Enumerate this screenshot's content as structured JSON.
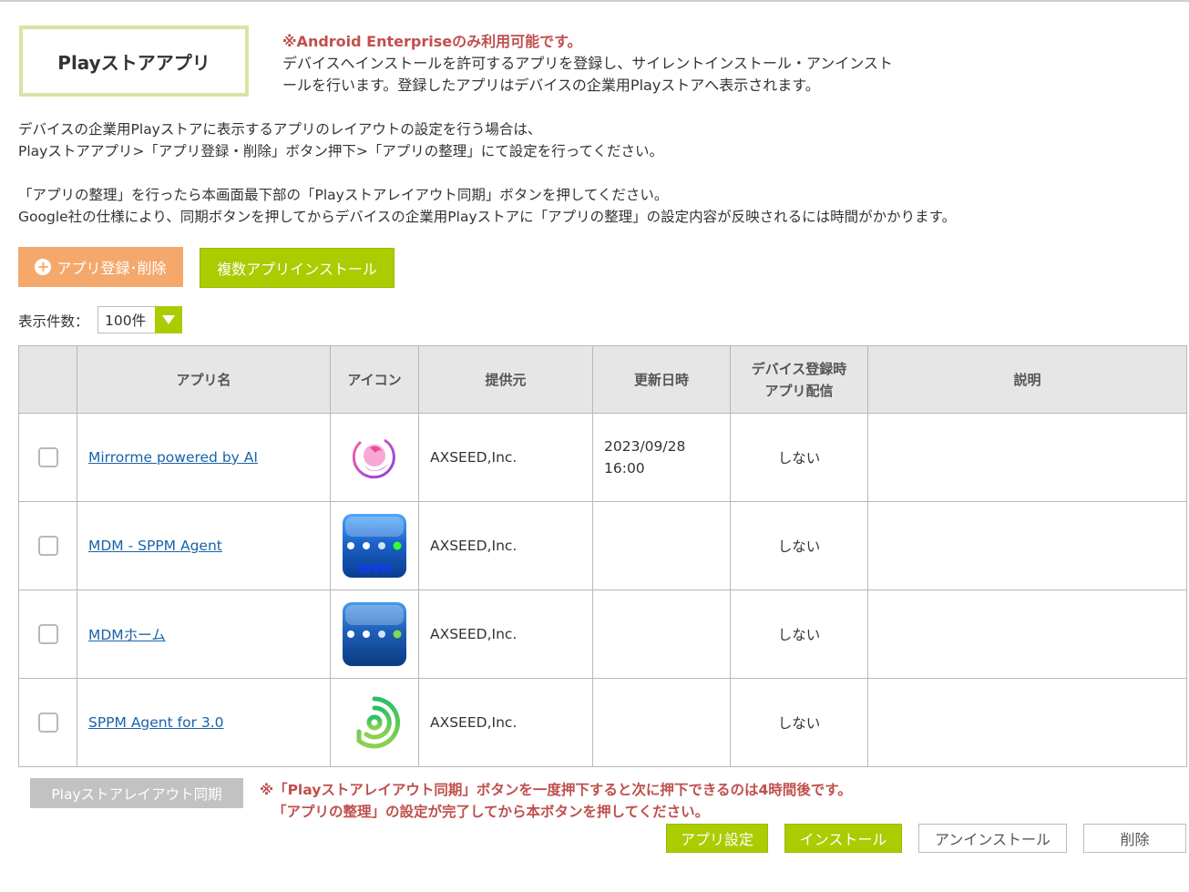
{
  "page": {
    "title": "Playストアアプリ",
    "notice": "※Android Enterpriseのみ利用可能です。",
    "description_line1": "デバイスへインストールを許可するアプリを登録し、サイレントインストール・アンインスト",
    "description_line2": "ールを行います。登録したアプリはデバイスの企業用Playストアへ表示されます。",
    "info_line1": "デバイスの企業用Playストアに表示するアプリのレイアウトの設定を行う場合は、",
    "info_line2": "Playストアアプリ>「アプリ登録・削除」ボタン押下>「アプリの整理」にて設定を行ってください。",
    "info_line3": "「アプリの整理」を行ったら本画面最下部の「Playストアレイアウト同期」ボタンを押してください。",
    "info_line4": "Google社の仕様により、同期ボタンを押してからデバイスの企業用Playストアに「アプリの整理」の設定内容が反映されるには時間がかかります。"
  },
  "toolbar": {
    "register_label": "アプリ登録･削除",
    "multi_install_label": "複数アプリインストール"
  },
  "pager": {
    "count_label": "表示件数：",
    "count_value": "100件"
  },
  "table": {
    "headers": {
      "name": "アプリ名",
      "icon": "アイコン",
      "provider": "提供元",
      "updated": "更新日時",
      "delivery_line1": "デバイス登録時",
      "delivery_line2": "アプリ配信",
      "description": "説明"
    },
    "rows": [
      {
        "name": "Mirrorme powered by AI",
        "icon": "mirrorme-icon",
        "provider": "AXSEED,Inc.",
        "updated_date": "2023/09/28",
        "updated_time": "16:00",
        "delivery": "しない",
        "description": ""
      },
      {
        "name": "MDM - SPPM Agent",
        "icon": "sppm-agent-icon",
        "provider": "AXSEED,Inc.",
        "updated_date": "",
        "updated_time": "",
        "delivery": "しない",
        "description": ""
      },
      {
        "name": "MDMホーム",
        "icon": "mdm-home-icon",
        "provider": "AXSEED,Inc.",
        "updated_date": "",
        "updated_time": "",
        "delivery": "しない",
        "description": ""
      },
      {
        "name": "SPPM Agent for 3.0",
        "icon": "sppm-agent-3-icon",
        "provider": "AXSEED,Inc.",
        "updated_date": "",
        "updated_time": "",
        "delivery": "しない",
        "description": ""
      }
    ]
  },
  "footer": {
    "sync_label": "Playストアレイアウト同期",
    "sync_note_line1": "※「Playストアレイアウト同期」ボタンを一度押下すると次に押下できるのは4時間後です。",
    "sync_note_line2": "「アプリの整理」の設定が完了してから本ボタンを押してください。",
    "app_setting_label": "アプリ設定",
    "install_label": "インストール",
    "uninstall_label": "アンインストール",
    "delete_label": "削除"
  },
  "colors": {
    "accent_green": "#aacc00",
    "accent_orange": "#f5a86c",
    "warning_red": "#c0504d",
    "title_border": "#d6e5a4"
  }
}
